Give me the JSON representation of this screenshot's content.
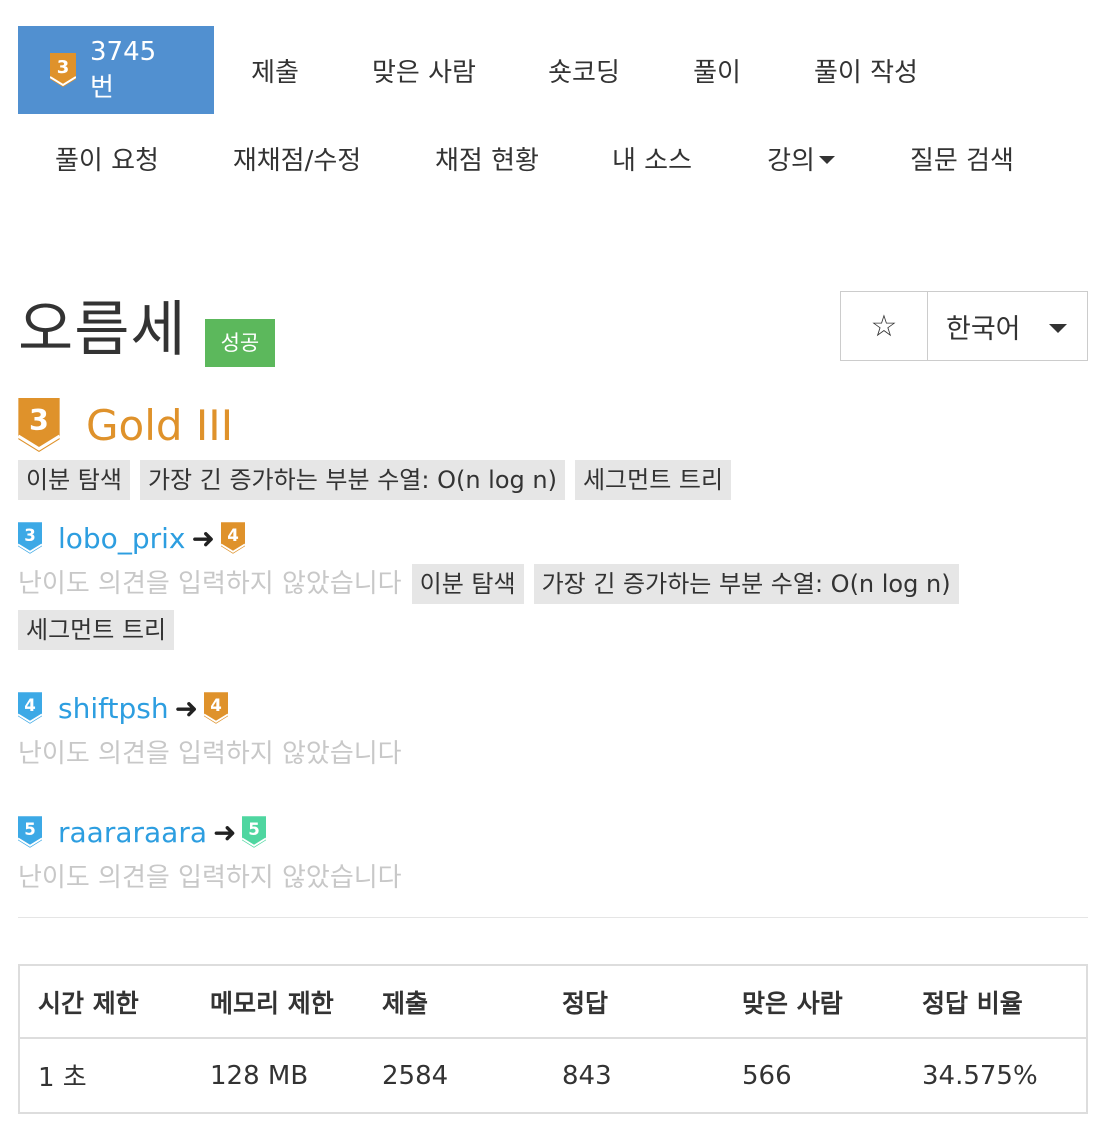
{
  "nav_primary": {
    "problem_number": "3745번",
    "problem_tier_level": "3",
    "items": [
      "제출",
      "맞은 사람",
      "숏코딩",
      "풀이",
      "풀이 작성"
    ]
  },
  "nav_secondary": {
    "items": [
      "풀이 요청",
      "재채점/수정",
      "채점 현황",
      "내 소스",
      "강의",
      "질문 검색"
    ]
  },
  "problem": {
    "title": "오름세",
    "status": "성공",
    "tier_level": "3",
    "tier_name": "Gold III",
    "tags": [
      "이분 탐색",
      "가장 긴 증가하는 부분 수열: O(n log n)",
      "세그먼트 트리"
    ]
  },
  "controls": {
    "star_icon": "☆",
    "language": "한국어"
  },
  "opinions": [
    {
      "user_level": "3",
      "user_level_color": "#3ca9e6",
      "user": "lobo_prix",
      "vote_level": "4",
      "vote_color": "#df922b",
      "comment": "난이도 의견을 입력하지 않았습니다",
      "tags": [
        "이분 탐색",
        "가장 긴 증가하는 부분 수열: O(n log n)",
        "세그먼트 트리"
      ]
    },
    {
      "user_level": "4",
      "user_level_color": "#3ca9e6",
      "user": "shiftpsh",
      "vote_level": "4",
      "vote_color": "#df922b",
      "comment": "난이도 의견을 입력하지 않았습니다",
      "tags": []
    },
    {
      "user_level": "5",
      "user_level_color": "#3ca9e6",
      "user": "raararaara",
      "vote_level": "5",
      "vote_color": "#4fd6a0",
      "comment": "난이도 의견을 입력하지 않았습니다",
      "tags": []
    }
  ],
  "stats": {
    "headers": [
      "시간 제한",
      "메모리 제한",
      "제출",
      "정답",
      "맞은 사람",
      "정답 비율"
    ],
    "values": [
      "1 초",
      "128 MB",
      "2584",
      "843",
      "566",
      "34.575%"
    ]
  },
  "colors": {
    "nav_active": "#5190d0",
    "gold": "#df922b",
    "success": "#5cb85c",
    "link": "#2d9ee0"
  }
}
